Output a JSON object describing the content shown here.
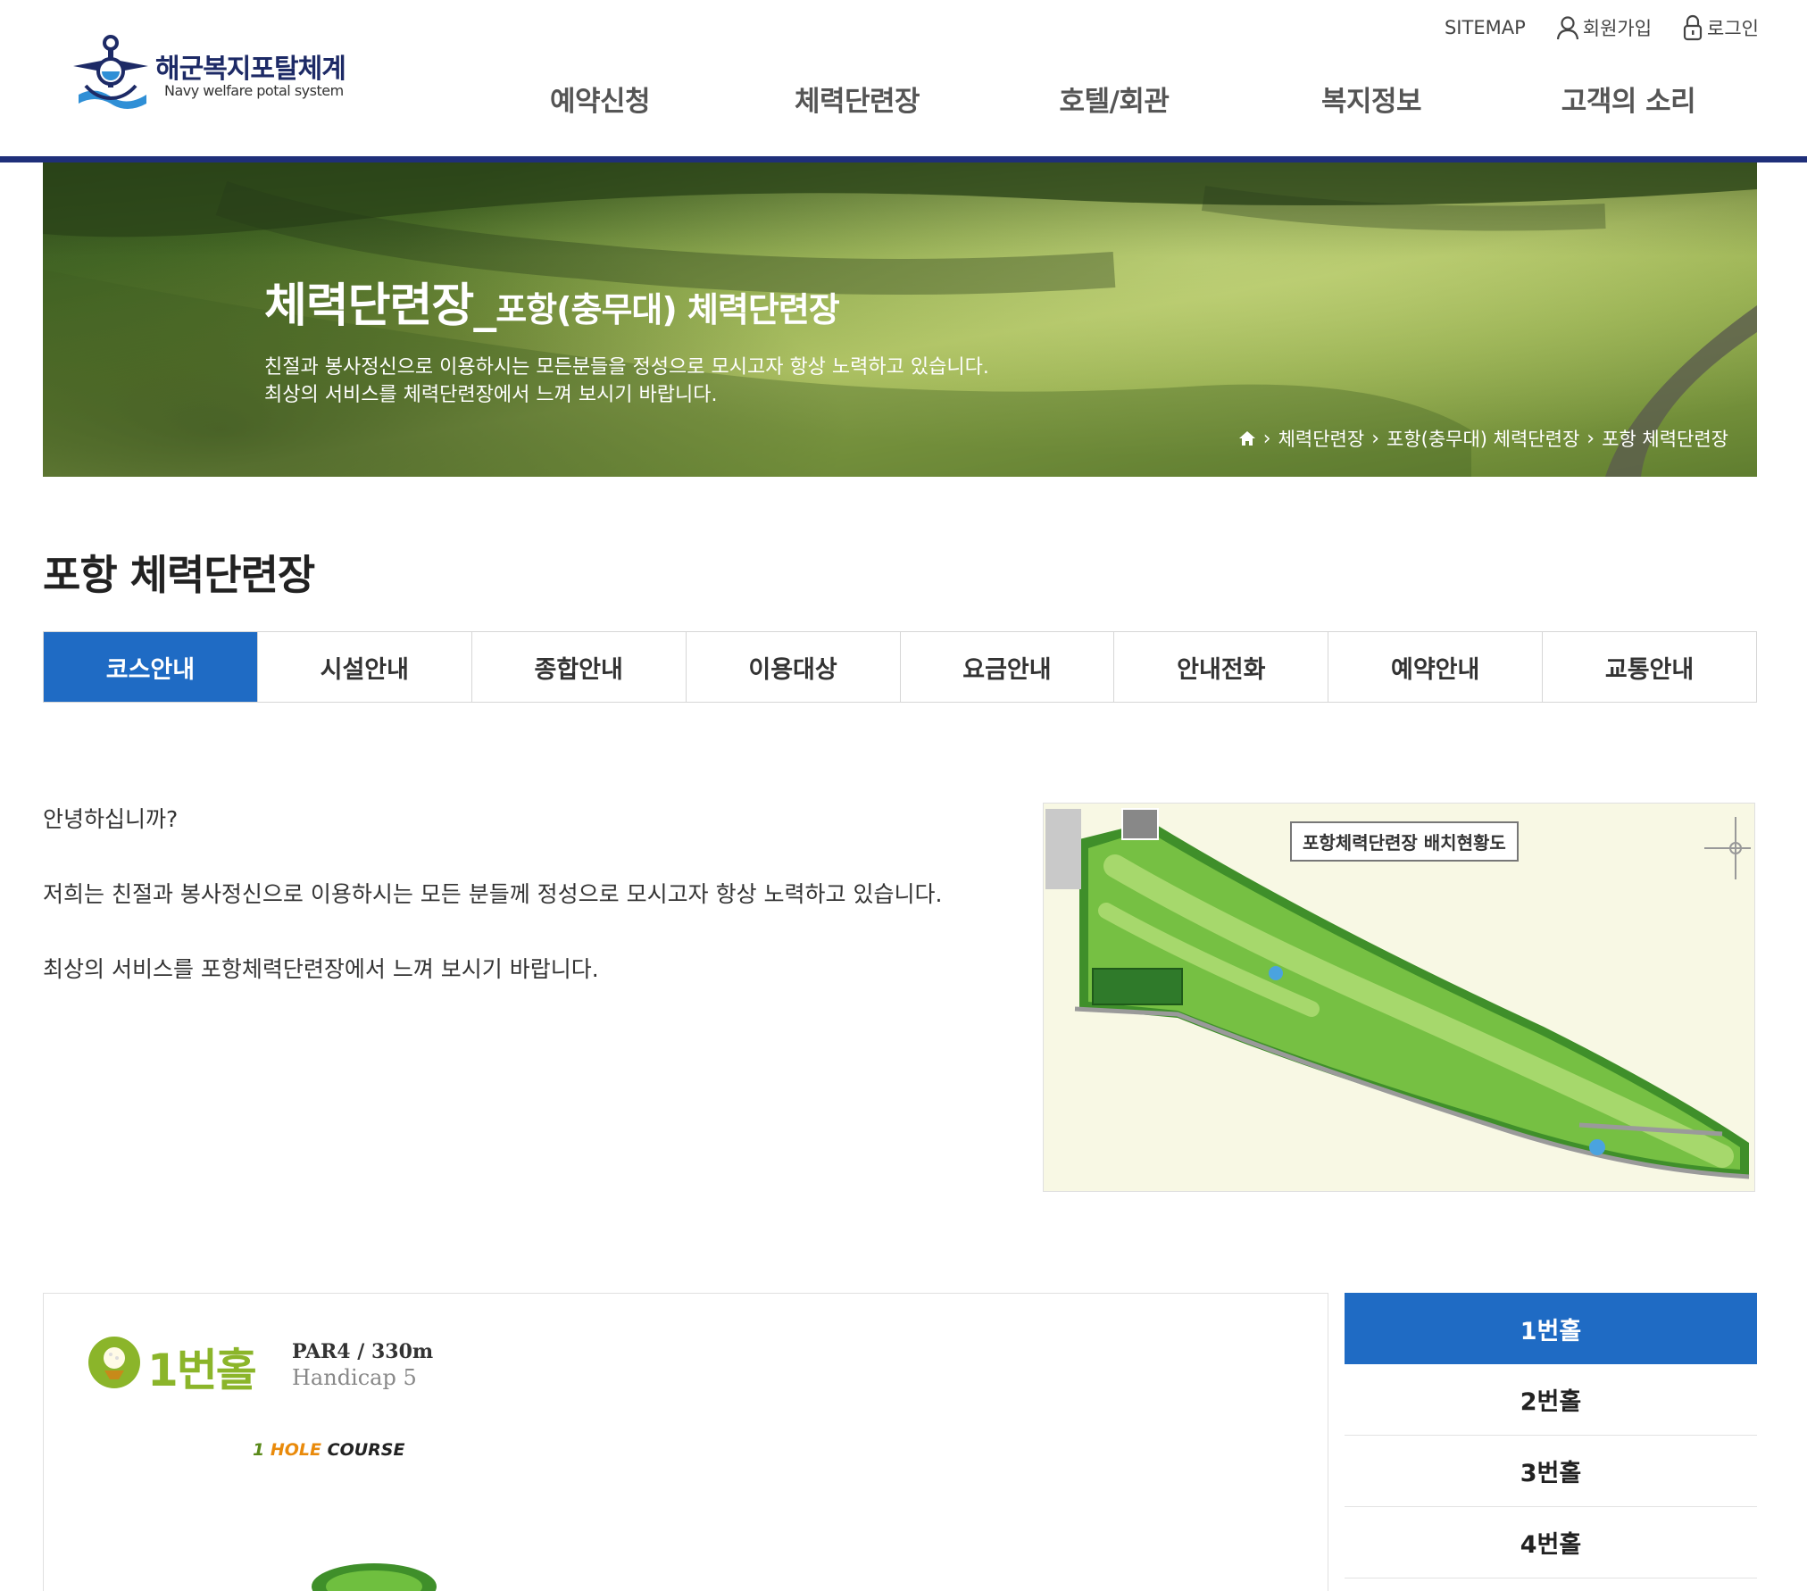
{
  "site": {
    "title": "해군복지포탈체계",
    "subtitle": "Navy welfare potal system"
  },
  "util": {
    "sitemap": "SITEMAP",
    "signup": "회원가입",
    "login": "로그인"
  },
  "gnb": [
    "예약신청",
    "체력단련장",
    "호텔/회관",
    "복지정보",
    "고객의 소리"
  ],
  "banner": {
    "title_main": "체력단련장_",
    "title_sub": "포항(충무대) 체력단련장",
    "desc_line1": "친절과 봉사정신으로 이용하시는 모든분들을 정성으로 모시고자 항상 노력하고 있습니다.",
    "desc_line2": "최상의 서비스를 체력단련장에서 느껴 보시기 바랍니다.",
    "breadcrumb": [
      "체력단련장",
      "포항(충무대) 체력단련장",
      "포항 체력단련장"
    ]
  },
  "page_title": "포항 체력단련장",
  "tabs": [
    "코스안내",
    "시설안내",
    "종합안내",
    "이용대상",
    "요금안내",
    "안내전화",
    "예약안내",
    "교통안내"
  ],
  "intro": {
    "greeting": "안녕하십니까?",
    "line1": "저희는 친절과 봉사정신으로 이용하시는 모든 분들께 정성으로 모시고자 항상 노력하고 있습니다.",
    "line2": "최상의 서비스를 포항체력단련장에서 느껴 보시기 바랍니다."
  },
  "map": {
    "label": "포항체력단련장 배치현황도"
  },
  "hole": {
    "number": "1번홀",
    "par": "PAR4 / 330m",
    "handicap": "Handicap 5",
    "course_num": "1",
    "course_hl": "HOLE",
    "course_rest": "COURSE"
  },
  "hole_list": [
    "1번홀",
    "2번홀",
    "3번홀",
    "4번홀"
  ],
  "colors": {
    "accent": "#1f6bc4",
    "header_border": "#1f2f7a",
    "hole_green": "#8bb52a"
  }
}
